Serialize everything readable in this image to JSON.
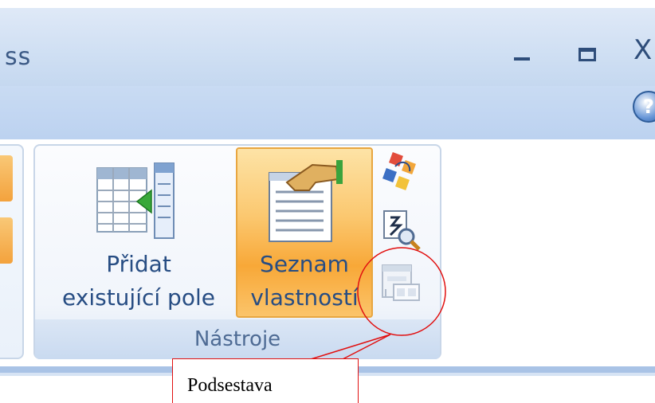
{
  "window": {
    "title_fragment": "ss",
    "close_label": "X",
    "help_label": "?"
  },
  "ribbon": {
    "group_label": "Nástroje",
    "add_fields_button": {
      "line1": "Přidat",
      "line2": "existující pole",
      "icon": "add-existing-fields-icon"
    },
    "property_sheet_button": {
      "line1": "Seznam",
      "line2": "vlastností",
      "state": "active",
      "icon": "property-sheet-icon"
    },
    "small_buttons": [
      {
        "icon": "tab-order-icon"
      },
      {
        "icon": "view-code-icon"
      },
      {
        "icon": "subform-icon",
        "state": "disabled"
      }
    ]
  },
  "annotation": {
    "callout_text": "Podsestava",
    "color": "#e11010"
  },
  "colors": {
    "accent_active": "#f8a838",
    "ribbon_text": "#274d83",
    "titlebar_bg": "#cfdff3"
  }
}
